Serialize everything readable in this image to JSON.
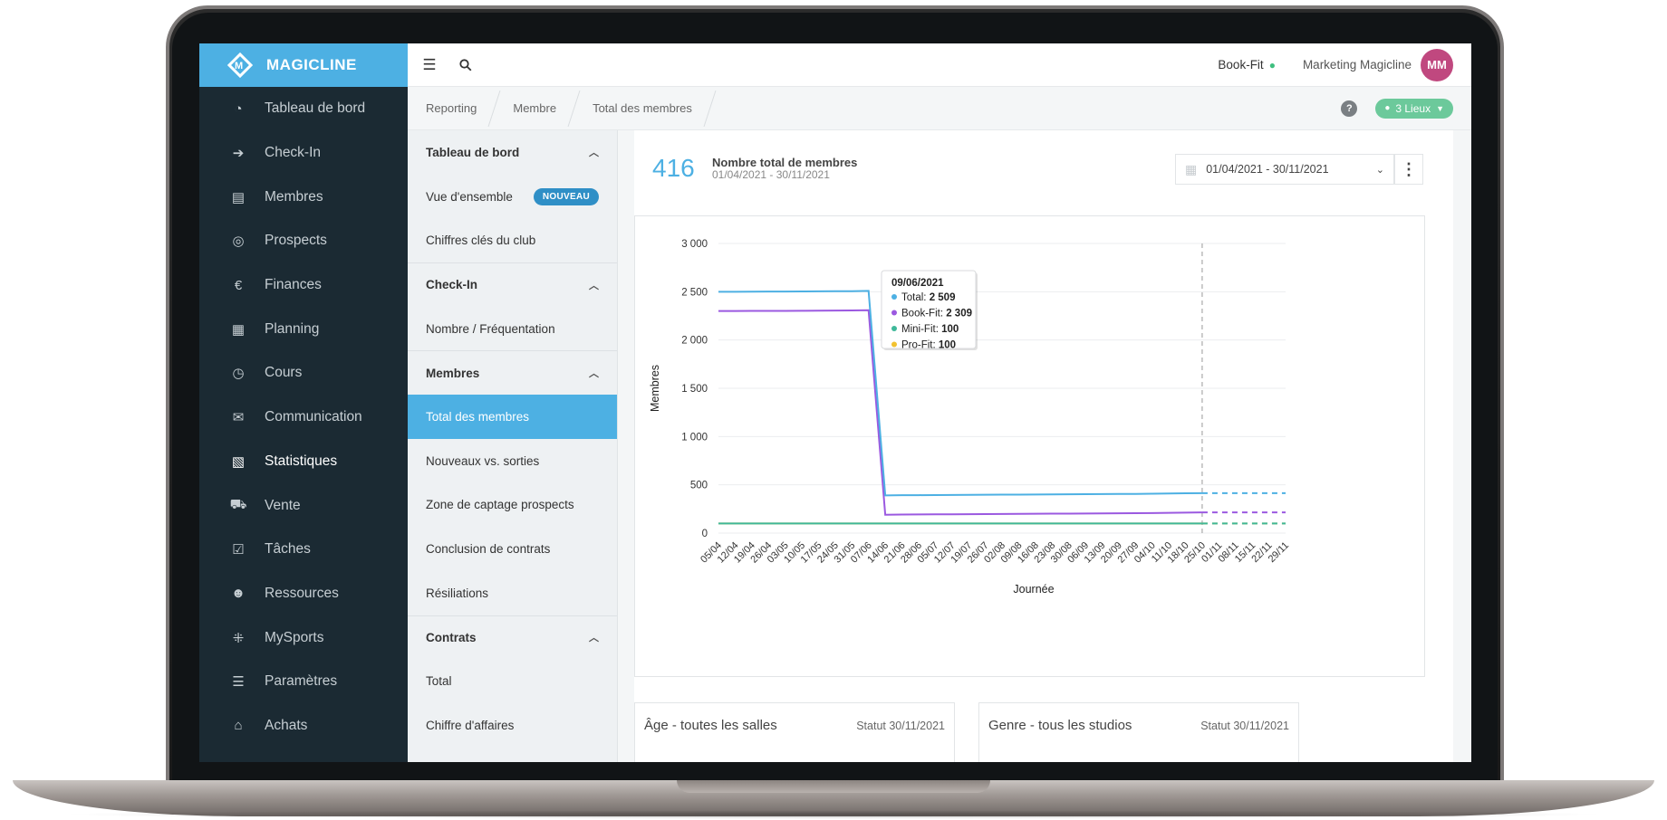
{
  "brand": {
    "name": "MAGICLINE",
    "color": "#4db0e3"
  },
  "sidebar": {
    "items": [
      {
        "label": "Tableau de bord",
        "icon": "gauge-icon",
        "glyph": "◔"
      },
      {
        "label": "Check-In",
        "icon": "login-icon",
        "glyph": "➔"
      },
      {
        "label": "Membres",
        "icon": "inbox-icon",
        "glyph": "▤"
      },
      {
        "label": "Prospects",
        "icon": "target-icon",
        "glyph": "◎"
      },
      {
        "label": "Finances",
        "icon": "euro-icon",
        "glyph": "€"
      },
      {
        "label": "Planning",
        "icon": "calendar-icon",
        "glyph": "▦"
      },
      {
        "label": "Cours",
        "icon": "stopwatch-icon",
        "glyph": "◷"
      },
      {
        "label": "Communication",
        "icon": "chat-icon",
        "glyph": "✉"
      },
      {
        "label": "Statistiques",
        "icon": "chart-icon",
        "glyph": "▧",
        "active": true
      },
      {
        "label": "Vente",
        "icon": "cart-icon",
        "glyph": "⛟"
      },
      {
        "label": "Tâches",
        "icon": "checkbox-icon",
        "glyph": "☑"
      },
      {
        "label": "Ressources",
        "icon": "people-icon",
        "glyph": "☻"
      },
      {
        "label": "MySports",
        "icon": "dots-grid-icon",
        "glyph": "⁜"
      },
      {
        "label": "Paramètres",
        "icon": "sliders-icon",
        "glyph": "☰"
      },
      {
        "label": "Achats",
        "icon": "store-icon",
        "glyph": "⌂"
      }
    ]
  },
  "topbar": {
    "studio": "Book-Fit",
    "user": "Marketing Magicline",
    "avatar_initials": "MM"
  },
  "breadcrumb": [
    "Reporting",
    "Membre",
    "Total des membres"
  ],
  "lieux_label": "3 Lieux",
  "submenu": {
    "sections": [
      {
        "title": "Tableau de bord",
        "items": [
          {
            "label": "Vue d'ensemble",
            "badge": "NOUVEAU"
          },
          {
            "label": "Chiffres clés du club"
          }
        ]
      },
      {
        "title": "Check-In",
        "items": [
          {
            "label": "Nombre / Fréquentation"
          }
        ]
      },
      {
        "title": "Membres",
        "items": [
          {
            "label": "Total des membres",
            "active": true
          },
          {
            "label": "Nouveaux vs. sorties"
          },
          {
            "label": "Zone de captage prospects"
          },
          {
            "label": "Conclusion de contrats"
          },
          {
            "label": "Résiliations"
          }
        ]
      },
      {
        "title": "Contrats",
        "items": [
          {
            "label": "Total"
          },
          {
            "label": "Chiffre d'affaires"
          }
        ]
      }
    ]
  },
  "kpi": {
    "value": "416",
    "title": "Nombre total de membres",
    "range": "01/04/2021 - 30/11/2021"
  },
  "date_filter": "01/04/2021 - 30/11/2021",
  "chart_data": {
    "type": "line",
    "xlabel": "Journée",
    "ylabel": "Membres",
    "ylim": [
      0,
      3000
    ],
    "yticks": [
      "0",
      "500",
      "1 000",
      "1 500",
      "2 000",
      "2 500",
      "3 000"
    ],
    "x": [
      "05/04",
      "12/04",
      "19/04",
      "26/04",
      "03/05",
      "10/05",
      "17/05",
      "24/05",
      "31/05",
      "07/06",
      "14/06",
      "21/06",
      "28/06",
      "05/07",
      "12/07",
      "19/07",
      "26/07",
      "02/08",
      "09/08",
      "16/08",
      "23/08",
      "30/08",
      "06/09",
      "13/09",
      "20/09",
      "27/09",
      "04/10",
      "11/10",
      "18/10",
      "25/10",
      "01/11",
      "08/11",
      "15/11",
      "22/11",
      "29/11"
    ],
    "forecast_from_index": 29,
    "series": [
      {
        "name": "Total",
        "color": "#4db0e3",
        "values": [
          2500,
          2500,
          2501,
          2502,
          2502,
          2503,
          2504,
          2505,
          2506,
          2509,
          390,
          392,
          393,
          394,
          395,
          396,
          397,
          398,
          399,
          400,
          401,
          402,
          403,
          404,
          405,
          406,
          408,
          410,
          412,
          414,
          414,
          414,
          414,
          414,
          414
        ]
      },
      {
        "name": "Book-Fit",
        "color": "#9b59e0",
        "values": [
          2300,
          2300,
          2301,
          2302,
          2302,
          2303,
          2304,
          2305,
          2306,
          2309,
          190,
          192,
          193,
          194,
          195,
          196,
          197,
          198,
          199,
          200,
          201,
          202,
          203,
          204,
          205,
          206,
          208,
          210,
          212,
          214,
          214,
          214,
          214,
          214,
          214
        ]
      },
      {
        "name": "Mini-Fit",
        "color": "#3fb89a",
        "values": [
          100,
          100,
          100,
          100,
          100,
          100,
          100,
          100,
          100,
          100,
          100,
          100,
          100,
          100,
          100,
          100,
          100,
          100,
          100,
          100,
          100,
          100,
          100,
          100,
          100,
          100,
          100,
          100,
          100,
          100,
          100,
          100,
          100,
          100,
          100
        ]
      },
      {
        "name": "Pro-Fit",
        "color": "#f2c230",
        "values": [
          100,
          100,
          100,
          100,
          100,
          100,
          100,
          100,
          100,
          100,
          100,
          100,
          100,
          100,
          100,
          100,
          100,
          100,
          100,
          100,
          100,
          100,
          100,
          100,
          100,
          100,
          100,
          100,
          100,
          100,
          100,
          100,
          100,
          100,
          100
        ]
      }
    ],
    "tooltip": {
      "date": "09/06/2021",
      "rows": [
        {
          "label": "Total:",
          "value": "2 509",
          "color": "#4db0e3"
        },
        {
          "label": "Book-Fit:",
          "value": "2 309",
          "color": "#9b59e0"
        },
        {
          "label": "Mini-Fit:",
          "value": "100",
          "color": "#3fb89a"
        },
        {
          "label": "Pro-Fit:",
          "value": "100",
          "color": "#f2c230"
        }
      ]
    }
  },
  "cards": [
    {
      "title": "Âge - toutes les salles",
      "status": "Statut 30/11/2021"
    },
    {
      "title": "Genre - tous les studios",
      "status": "Statut 30/11/2021"
    }
  ]
}
